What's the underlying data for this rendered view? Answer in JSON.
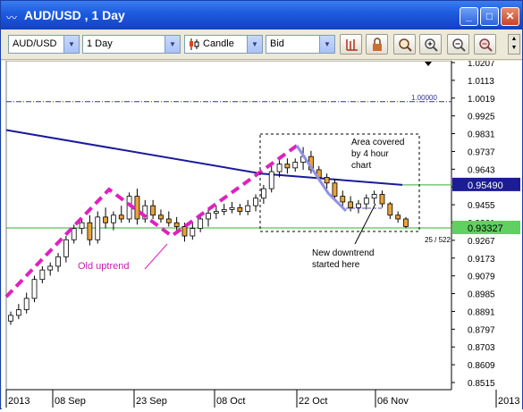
{
  "window": {
    "title": "AUD/USD , 1 Day",
    "icon_name": "chart-app-icon",
    "minimize_label": "_",
    "maximize_label": "□",
    "close_label": "✕"
  },
  "toolbar": {
    "symbol": "AUD/USD",
    "period": "1 Day",
    "chart_type": "Candle",
    "price_type": "Bid",
    "tools": [
      "bar-chart-icon",
      "lock-icon",
      "zoom-fit-icon",
      "zoom-in-icon",
      "zoom-out-icon",
      "zoom-reset-icon"
    ]
  },
  "chart": {
    "price_axis_labels": [
      "1.0207",
      "1.0113",
      "1.0019",
      "0.9925",
      "0.9831",
      "0.9737",
      "0.9643",
      "0.9549",
      "0.9455",
      "0.9361",
      "0.9267",
      "0.9173",
      "0.9079",
      "0.8985",
      "0.8891",
      "0.8797",
      "0.8703",
      "0.8609",
      "0.8515"
    ],
    "date_axis_labels": [
      "2013",
      "08 Sep",
      "23 Sep",
      "08 Oct",
      "22 Oct",
      "06 Nov",
      "2013"
    ],
    "parity_label": "1.00000",
    "moving_average_tag": "0.95490",
    "last_price_tag": "0.93327",
    "bar_count": "25 / 522",
    "annotations": {
      "old_uptrend": "Old uptrend",
      "area_covered": [
        "Area covered",
        "by 4 hour",
        "chart"
      ],
      "new_downtrend": [
        "New downtrend",
        "started here"
      ]
    },
    "colors": {
      "up_candle": "#ffffff",
      "down_candle": "#e8a33b",
      "moving_average": "#1a1a9a",
      "uptrend_line": "#e020c0",
      "downtrend_line": "#8080e0",
      "last_price_line": "#30b030",
      "parity_line": "#3030a0"
    }
  },
  "chart_data": {
    "type": "candlestick",
    "ylim": [
      0.8515,
      1.0207
    ],
    "candles": [
      {
        "o": 0.884,
        "h": 0.889,
        "l": 0.882,
        "c": 0.887
      },
      {
        "o": 0.887,
        "h": 0.893,
        "l": 0.885,
        "c": 0.89
      },
      {
        "o": 0.89,
        "h": 0.899,
        "l": 0.888,
        "c": 0.896
      },
      {
        "o": 0.896,
        "h": 0.908,
        "l": 0.894,
        "c": 0.906
      },
      {
        "o": 0.906,
        "h": 0.913,
        "l": 0.904,
        "c": 0.911
      },
      {
        "o": 0.911,
        "h": 0.915,
        "l": 0.908,
        "c": 0.913
      },
      {
        "o": 0.913,
        "h": 0.92,
        "l": 0.91,
        "c": 0.918
      },
      {
        "o": 0.918,
        "h": 0.929,
        "l": 0.915,
        "c": 0.927
      },
      {
        "o": 0.927,
        "h": 0.935,
        "l": 0.925,
        "c": 0.933
      },
      {
        "o": 0.933,
        "h": 0.938,
        "l": 0.93,
        "c": 0.936
      },
      {
        "o": 0.936,
        "h": 0.94,
        "l": 0.924,
        "c": 0.927
      },
      {
        "o": 0.927,
        "h": 0.942,
        "l": 0.925,
        "c": 0.939
      },
      {
        "o": 0.939,
        "h": 0.944,
        "l": 0.933,
        "c": 0.936
      },
      {
        "o": 0.936,
        "h": 0.942,
        "l": 0.932,
        "c": 0.94
      },
      {
        "o": 0.94,
        "h": 0.945,
        "l": 0.936,
        "c": 0.938
      },
      {
        "o": 0.938,
        "h": 0.952,
        "l": 0.936,
        "c": 0.95
      },
      {
        "o": 0.95,
        "h": 0.954,
        "l": 0.935,
        "c": 0.938
      },
      {
        "o": 0.938,
        "h": 0.948,
        "l": 0.936,
        "c": 0.945
      },
      {
        "o": 0.945,
        "h": 0.948,
        "l": 0.938,
        "c": 0.94
      },
      {
        "o": 0.94,
        "h": 0.943,
        "l": 0.936,
        "c": 0.938
      },
      {
        "o": 0.938,
        "h": 0.942,
        "l": 0.934,
        "c": 0.936
      },
      {
        "o": 0.936,
        "h": 0.939,
        "l": 0.932,
        "c": 0.934
      },
      {
        "o": 0.934,
        "h": 0.936,
        "l": 0.926,
        "c": 0.929
      },
      {
        "o": 0.929,
        "h": 0.936,
        "l": 0.927,
        "c": 0.933
      },
      {
        "o": 0.933,
        "h": 0.94,
        "l": 0.931,
        "c": 0.938
      },
      {
        "o": 0.938,
        "h": 0.943,
        "l": 0.934,
        "c": 0.941
      },
      {
        "o": 0.941,
        "h": 0.945,
        "l": 0.938,
        "c": 0.942
      },
      {
        "o": 0.942,
        "h": 0.946,
        "l": 0.94,
        "c": 0.943
      },
      {
        "o": 0.943,
        "h": 0.947,
        "l": 0.941,
        "c": 0.944
      },
      {
        "o": 0.944,
        "h": 0.946,
        "l": 0.94,
        "c": 0.942
      },
      {
        "o": 0.942,
        "h": 0.948,
        "l": 0.94,
        "c": 0.945
      },
      {
        "o": 0.945,
        "h": 0.951,
        "l": 0.942,
        "c": 0.949
      },
      {
        "o": 0.949,
        "h": 0.956,
        "l": 0.946,
        "c": 0.954
      },
      {
        "o": 0.954,
        "h": 0.966,
        "l": 0.952,
        "c": 0.963
      },
      {
        "o": 0.963,
        "h": 0.969,
        "l": 0.96,
        "c": 0.967
      },
      {
        "o": 0.967,
        "h": 0.97,
        "l": 0.962,
        "c": 0.965
      },
      {
        "o": 0.965,
        "h": 0.97,
        "l": 0.963,
        "c": 0.968
      },
      {
        "o": 0.968,
        "h": 0.976,
        "l": 0.964,
        "c": 0.971
      },
      {
        "o": 0.971,
        "h": 0.974,
        "l": 0.962,
        "c": 0.964
      },
      {
        "o": 0.964,
        "h": 0.966,
        "l": 0.958,
        "c": 0.96
      },
      {
        "o": 0.96,
        "h": 0.962,
        "l": 0.954,
        "c": 0.957
      },
      {
        "o": 0.957,
        "h": 0.959,
        "l": 0.948,
        "c": 0.95
      },
      {
        "o": 0.95,
        "h": 0.953,
        "l": 0.944,
        "c": 0.947
      },
      {
        "o": 0.947,
        "h": 0.95,
        "l": 0.942,
        "c": 0.944
      },
      {
        "o": 0.944,
        "h": 0.948,
        "l": 0.941,
        "c": 0.946
      },
      {
        "o": 0.946,
        "h": 0.951,
        "l": 0.943,
        "c": 0.949
      },
      {
        "o": 0.949,
        "h": 0.953,
        "l": 0.946,
        "c": 0.951
      },
      {
        "o": 0.951,
        "h": 0.953,
        "l": 0.944,
        "c": 0.946
      },
      {
        "o": 0.946,
        "h": 0.947,
        "l": 0.938,
        "c": 0.94
      },
      {
        "o": 0.94,
        "h": 0.942,
        "l": 0.936,
        "c": 0.938
      },
      {
        "o": 0.938,
        "h": 0.939,
        "l": 0.933,
        "c": 0.934
      }
    ],
    "moving_average": [
      0.985,
      0.962,
      0.956
    ],
    "last_price": 0.93327,
    "parity": 1.0
  }
}
